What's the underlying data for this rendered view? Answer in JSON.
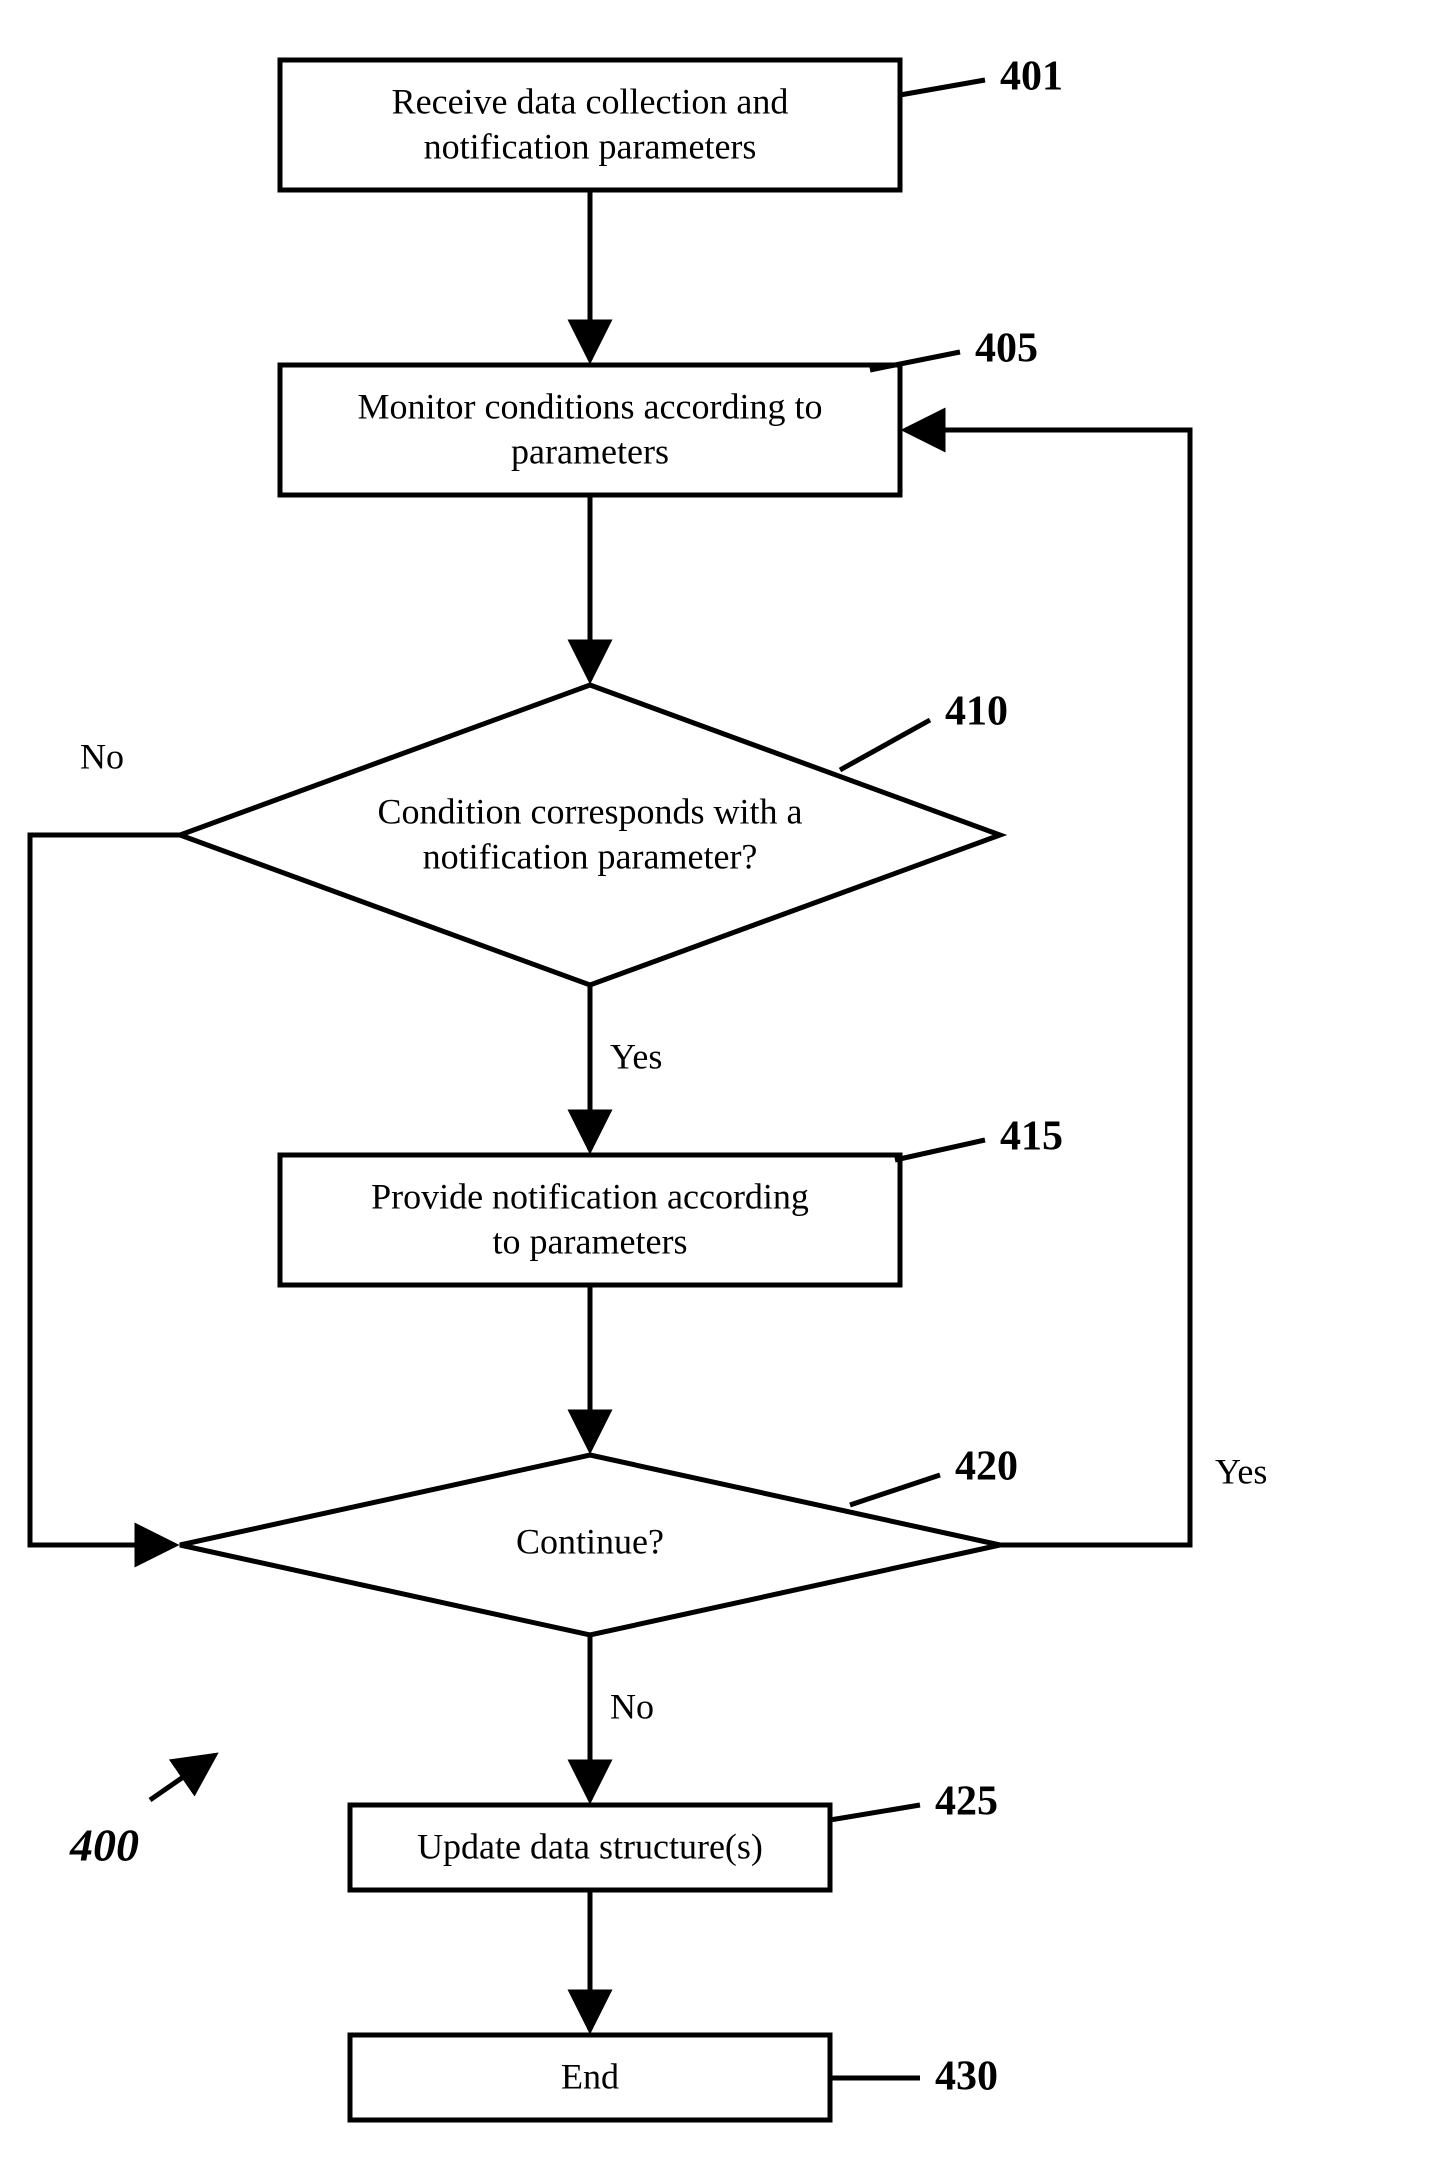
{
  "figure_ref": "400",
  "nodes": {
    "n401": {
      "ref": "401",
      "line1": "Receive data collection and",
      "line2": "notification parameters"
    },
    "n405": {
      "ref": "405",
      "line1": "Monitor conditions according to",
      "line2": "parameters"
    },
    "n410": {
      "ref": "410",
      "line1": "Condition corresponds with a",
      "line2": "notification parameter?"
    },
    "n415": {
      "ref": "415",
      "line1": "Provide notification according",
      "line2": "to parameters"
    },
    "n420": {
      "ref": "420",
      "line1": "Continue?"
    },
    "n425": {
      "ref": "425",
      "line1": "Update data structure(s)"
    },
    "n430": {
      "ref": "430",
      "line1": "End"
    }
  },
  "edge_labels": {
    "no_410": "No",
    "yes_410": "Yes",
    "yes_420": "Yes",
    "no_420": "No"
  }
}
